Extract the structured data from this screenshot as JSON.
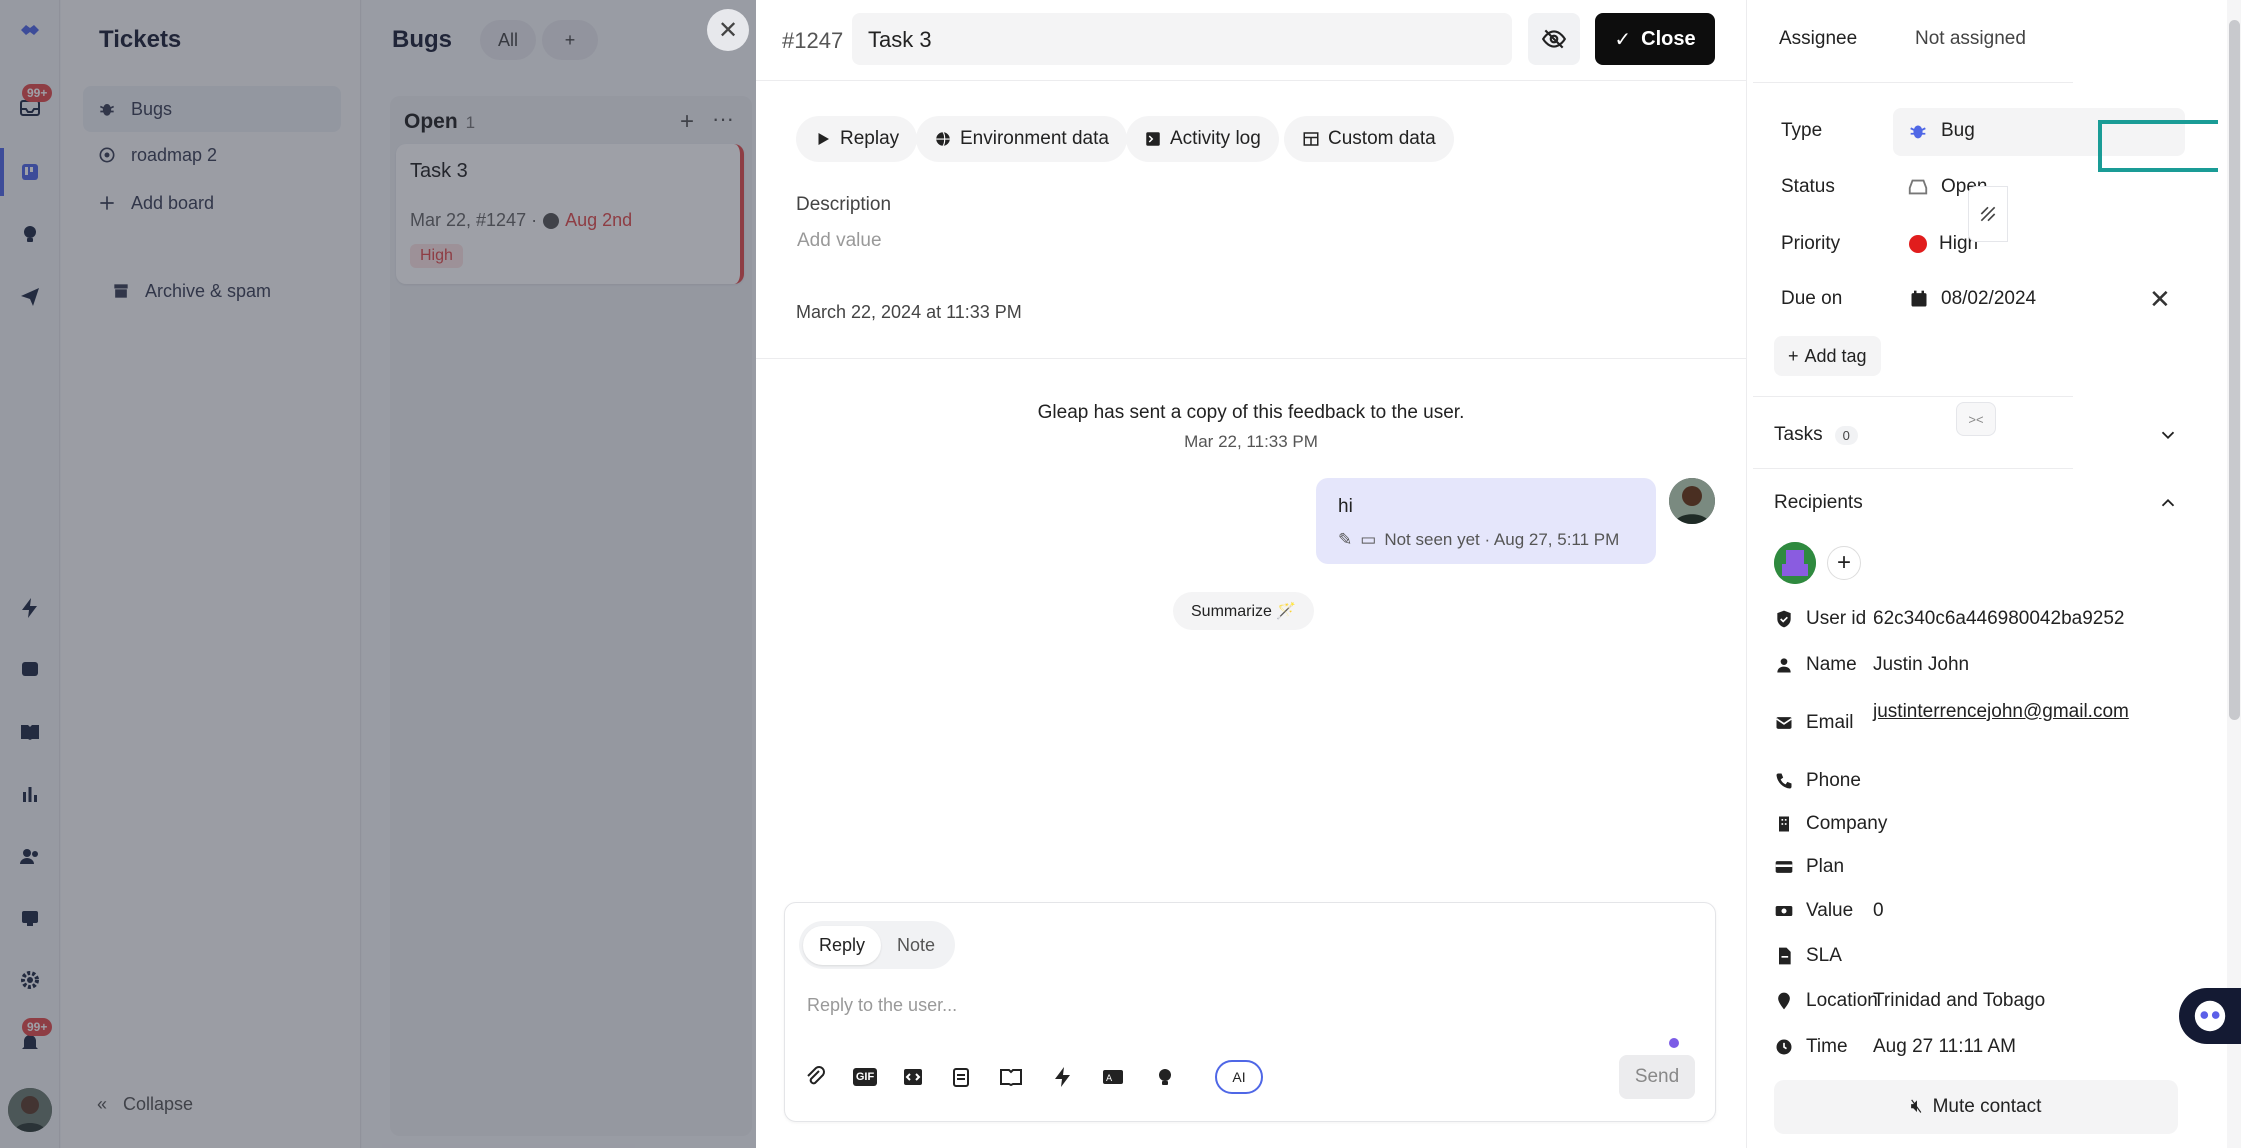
{
  "rail": {
    "inbox_badge": "99+",
    "notif_badge": "99+"
  },
  "sidenav": {
    "title": "Tickets",
    "items": [
      {
        "label": "Bugs",
        "icon": "bug-icon"
      },
      {
        "label": "roadmap 2",
        "icon": "target-icon"
      },
      {
        "label": "Add board",
        "icon": "plus-icon"
      },
      {
        "label": "Archive & spam",
        "icon": "archive-icon"
      }
    ],
    "collapse": "Collapse"
  },
  "board": {
    "title": "Bugs",
    "filter_all": "All",
    "filter_add": "+",
    "column": {
      "name": "Open",
      "count": "1"
    },
    "card": {
      "title": "Task 3",
      "meta": "Mar 22, #1247 ·",
      "due": "Aug 2nd",
      "tag": "High"
    }
  },
  "ticket": {
    "number": "#1247",
    "title": "Task 3",
    "close_label": "Close",
    "tabs": [
      "Replay",
      "Environment data",
      "Activity log",
      "Custom data"
    ],
    "description_label": "Description",
    "description_placeholder": "Add value",
    "created": "March 22, 2024 at 11:33 PM",
    "system_message": "Gleap has sent a copy of this feedback to the user.",
    "system_time": "Mar 22, 11:33 PM",
    "message": {
      "text": "hi",
      "meta": "Not seen yet · Aug 27, 5:11 PM"
    },
    "summarize": "Summarize 🪄"
  },
  "composer": {
    "mode_reply": "Reply",
    "mode_note": "Note",
    "placeholder": "Reply to the user...",
    "ai_label": "AI",
    "send_label": "Send",
    "gif_label": "GIF"
  },
  "details": {
    "assignee_label": "Assignee",
    "assignee_value": "Not assigned",
    "type_label": "Type",
    "type_value": "Bug",
    "status_label": "Status",
    "status_value": "Open",
    "priority_label": "Priority",
    "priority_value": "High",
    "priority_color": "#e11d1d",
    "due_label": "Due on",
    "due_value": "08/02/2024",
    "add_tag": "Add tag",
    "tasks_label": "Tasks",
    "tasks_count": "0",
    "recipients_label": "Recipients",
    "fields": [
      {
        "label": "User id",
        "value": "62c340c6a446980042ba9252",
        "icon": "shield-check-icon"
      },
      {
        "label": "Name",
        "value": "Justin John",
        "icon": "person-icon"
      },
      {
        "label": "Email",
        "value": "justinterrencejohn@gmail.com",
        "icon": "mail-icon"
      },
      {
        "label": "Phone",
        "value": "",
        "icon": "phone-icon"
      },
      {
        "label": "Company",
        "value": "",
        "icon": "building-icon"
      },
      {
        "label": "Plan",
        "value": "",
        "icon": "credit-card-icon"
      },
      {
        "label": "Value",
        "value": "0",
        "icon": "money-icon"
      },
      {
        "label": "SLA",
        "value": "",
        "icon": "file-icon"
      },
      {
        "label": "Location",
        "value": "Trinidad and Tobago",
        "icon": "pin-icon"
      },
      {
        "label": "Time",
        "value": "Aug 27 11:11 AM",
        "icon": "clock-icon"
      }
    ],
    "mute": "Mute contact"
  }
}
